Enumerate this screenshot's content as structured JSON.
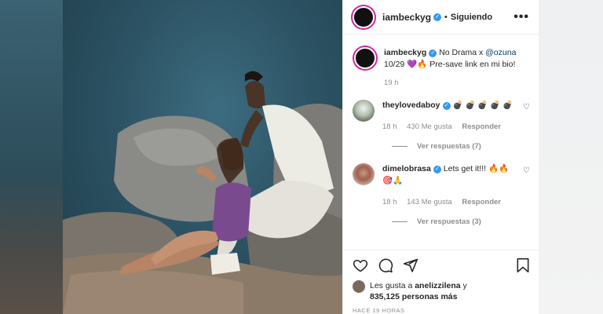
{
  "post": {
    "username": "iambeckyg",
    "follow_state": "Siguiendo",
    "separator": "•",
    "more": "•••"
  },
  "caption": {
    "username": "iambeckyg",
    "text_pre": "No Drama x ",
    "mention": "@ozuna",
    "text_post": "10/29 💜🔥 Pre-save link en mi bio!",
    "time": "19 h"
  },
  "comments": [
    {
      "username": "theylovedaboy",
      "text": "💣 💣 💣 💣 💣",
      "time": "18 h",
      "likes": "430 Me gusta",
      "reply": "Responder",
      "view_replies": "Ver respuestas (7)"
    },
    {
      "username": "dimelobrasa",
      "text": "Lets get it!!! 🔥🔥 🎯🙏",
      "time": "18 h",
      "likes": "143 Me gusta",
      "reply": "Responder",
      "view_replies": "Ver respuestas (3)"
    }
  ],
  "liked_by": {
    "prefix": "Les gusta a ",
    "user": "anelizzilena",
    "suffix": " y",
    "count": "835,125 personas más"
  },
  "timestamp": "HACE 19 HORAS",
  "icons": {
    "like": "heart-icon",
    "comment": "comment-icon",
    "share": "share-icon",
    "save": "bookmark-icon"
  },
  "colors": {
    "verified": "#3897f0",
    "muted": "#8e8e8e",
    "story_ring": "#d6249f"
  }
}
